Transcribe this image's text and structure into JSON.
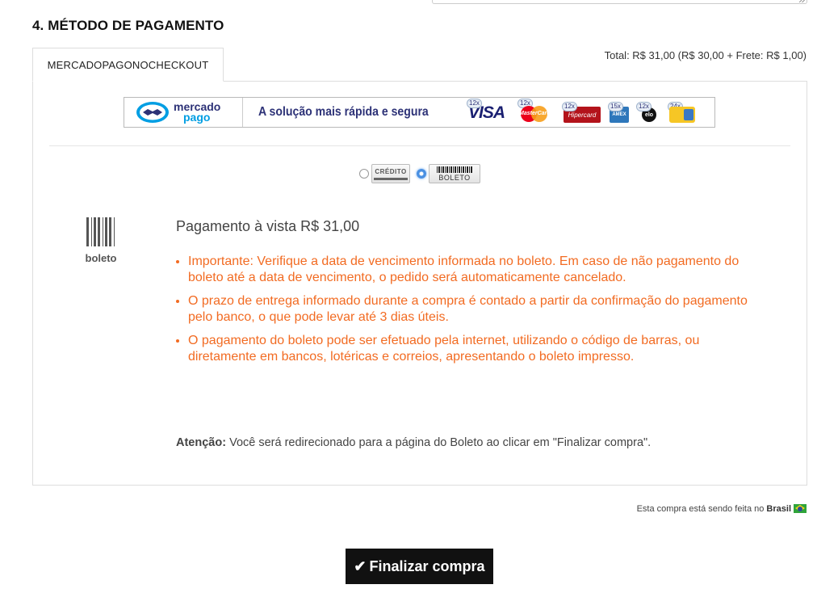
{
  "section": {
    "title": "4. MÉTODO DE PAGAMENTO"
  },
  "summary": {
    "total_text": "Total: R$ 31,00 (R$ 30,00 + Frete: R$ 1,00)"
  },
  "tabs": [
    {
      "label": "MERCADOPAGONOCHECKOUT",
      "active": true
    }
  ],
  "banner": {
    "brand_line1": "mercado",
    "brand_line2": "pago",
    "tagline": "A solução mais rápida e segura",
    "cards": [
      {
        "name": "VISA",
        "installments": "12x"
      },
      {
        "name": "MasterCard",
        "installments": "12x"
      },
      {
        "name": "Hipercard",
        "installments": "12x"
      },
      {
        "name": "American Express",
        "installments": "15x"
      },
      {
        "name": "elo",
        "installments": "12x"
      },
      {
        "name": "other-card",
        "installments": "24x"
      }
    ]
  },
  "methods": [
    {
      "label": "CRÉDITO",
      "selected": false
    },
    {
      "label": "BOLETO",
      "selected": true
    }
  ],
  "boleto": {
    "icon_label": "boleto",
    "title": "Pagamento à vista R$ 31,00",
    "notes": [
      "Importante: Verifique a data de vencimento informada no boleto. Em caso de não pagamento do boleto até a data de vencimento, o pedido será automaticamente cancelado.",
      "O prazo de entrega informado durante a compra é contado a partir da confirmação do pagamento pelo banco, o que pode levar até 3 dias úteis.",
      "O pagamento do boleto pode ser efetuado pela internet, utilizando o código de barras, ou diretamente em bancos, lotéricas e correios, apresentando o boleto impresso."
    ],
    "attention_label": "Atenção:",
    "attention_text": " Você será redirecionado para a página do Boleto ao clicar em \"Finalizar compra\"."
  },
  "country": {
    "prefix": "Esta compra está sendo feita no",
    "name": "Brasil"
  },
  "actions": {
    "finalize_label": "Finalizar compra"
  },
  "colors": {
    "accent_orange": "#f26b22",
    "button_bg": "#111111",
    "mp_navy": "#2d3277",
    "mp_blue": "#009ee3"
  }
}
